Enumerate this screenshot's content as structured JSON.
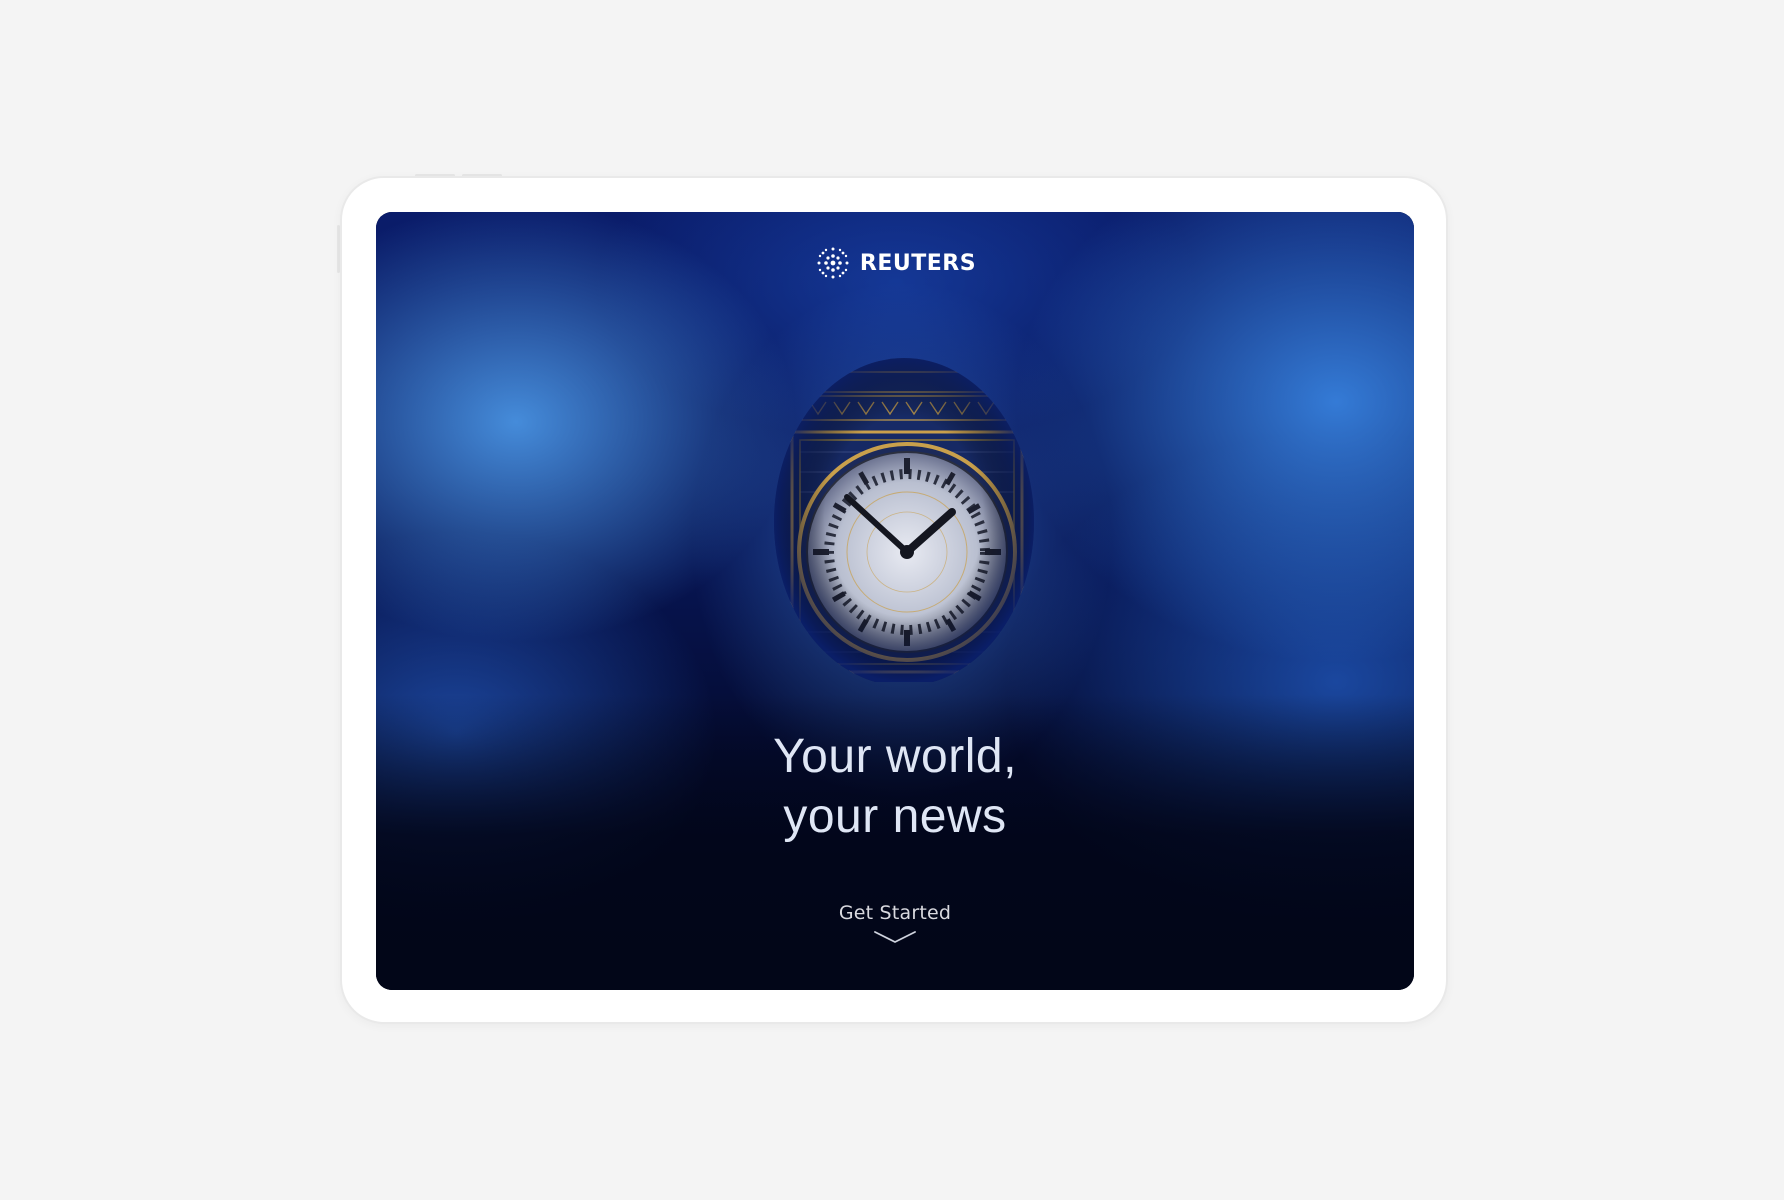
{
  "brand": {
    "name": "REUTERS",
    "logo_icon": "reuters-dot-globe-icon",
    "logo_color": "#ffffff"
  },
  "hero": {
    "headline_line1": "Your world,",
    "headline_line2": "your news",
    "image_subject": "clock-tower-icon"
  },
  "cta": {
    "label": "Get Started",
    "icon": "chevron-down-icon"
  },
  "colors": {
    "page_background": "#f4f4f4",
    "device_frame": "#ffffff",
    "screen_dark": "#020618",
    "screen_blue": "#1e5fd0",
    "clock_gold": "#c9a04c"
  }
}
